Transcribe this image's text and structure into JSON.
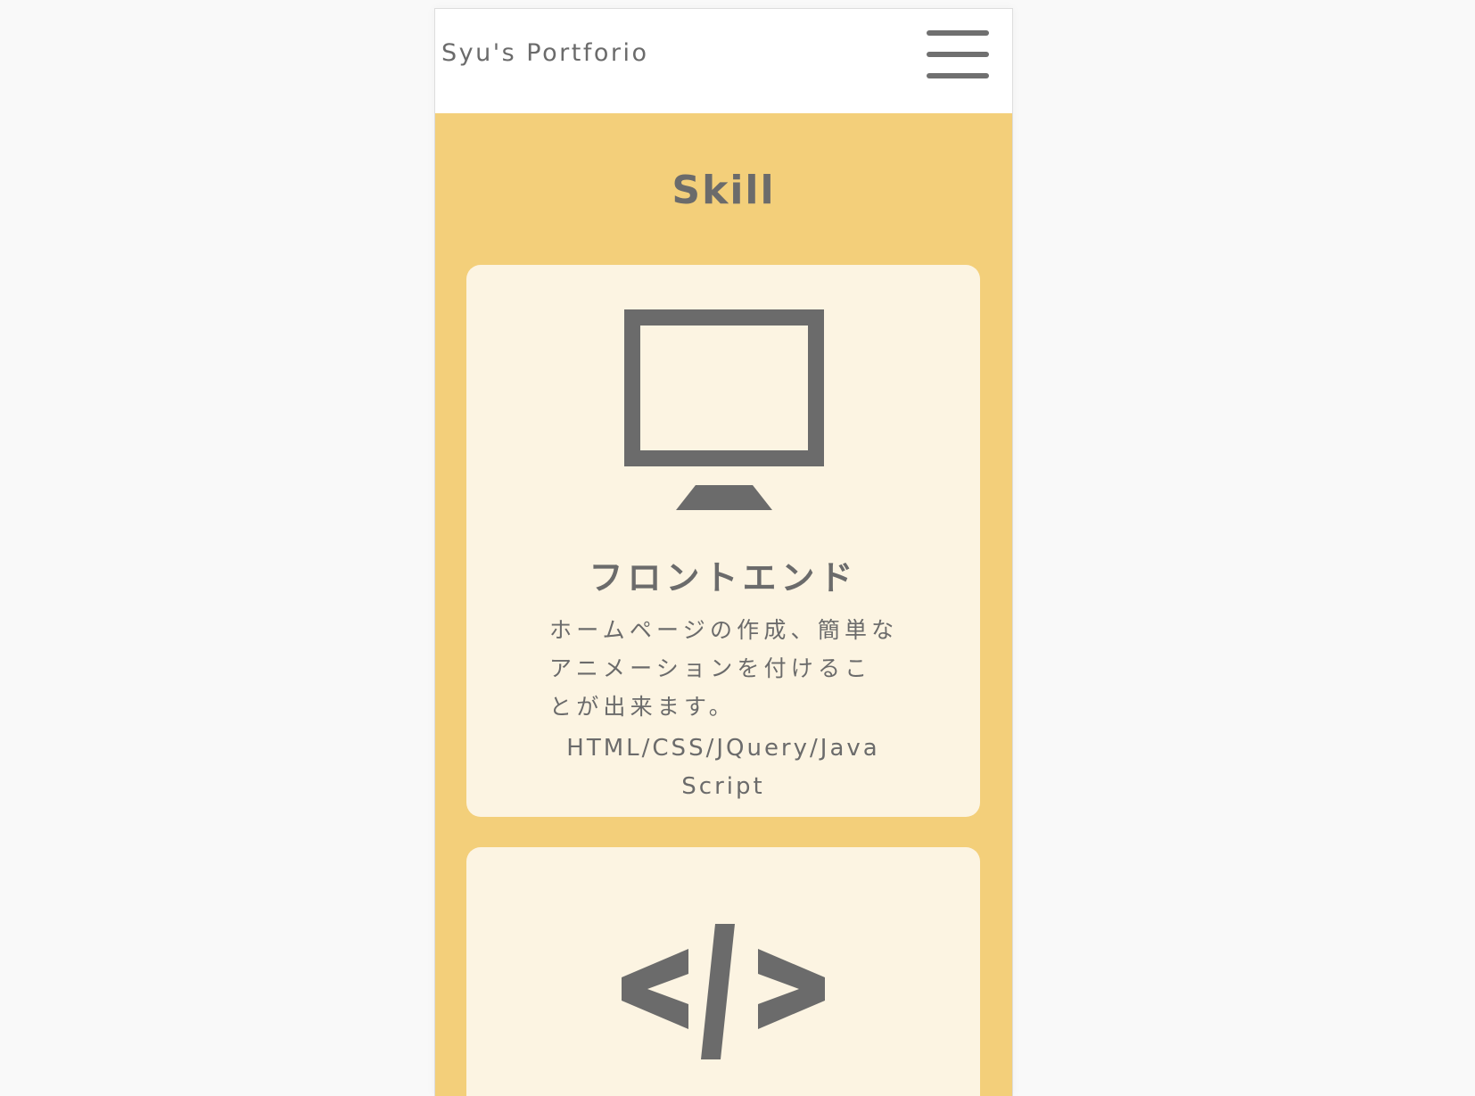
{
  "header": {
    "site_title": "Syu's Portforio",
    "menu_icon": "hamburger-menu-icon"
  },
  "skill": {
    "title": "Skill",
    "cards": [
      {
        "icon": "monitor-icon",
        "heading": "フロントエンド",
        "description_lines": [
          "ホームページの作成、簡単な",
          "アニメーションを付けるこ",
          "とが出来ます。"
        ],
        "tech_lines": [
          "HTML/CSS/JQuery/Java",
          "Script"
        ]
      },
      {
        "icon": "code-icon"
      }
    ]
  },
  "colors": {
    "page_background": "#f9f9f9",
    "header_background": "#ffffff",
    "section_background": "#f3cf7a",
    "card_background": "#fcf4e2",
    "text": "#6b6b6b",
    "icon": "#6b6b6b"
  }
}
